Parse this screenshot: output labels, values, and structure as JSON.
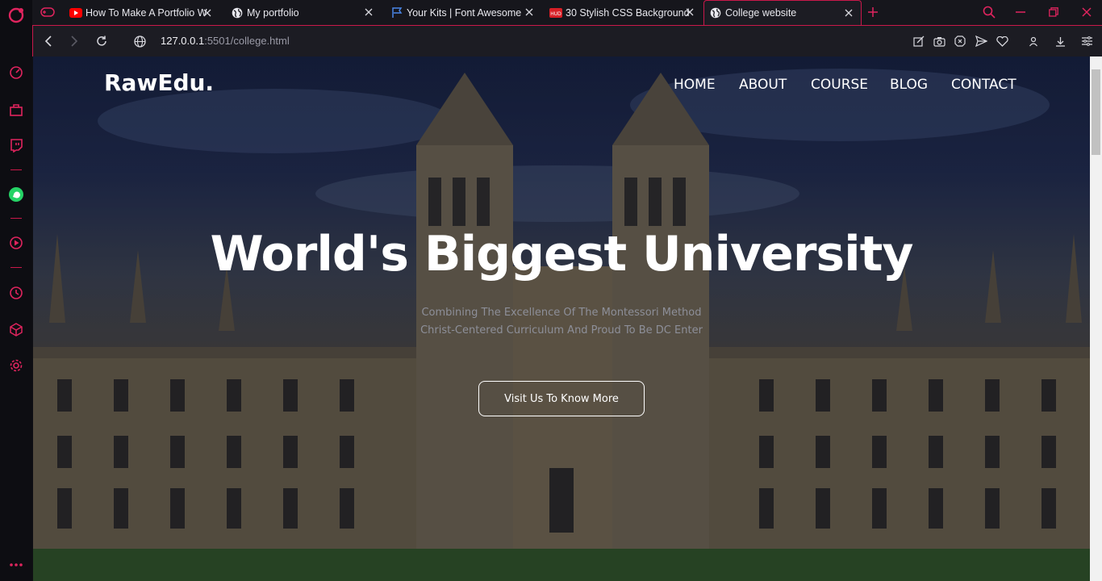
{
  "browser": {
    "tabs": [
      {
        "label": "How To Make A Portfolio W",
        "favicon": "youtube-icon"
      },
      {
        "label": "My portfolio",
        "favicon": "globe-icon"
      },
      {
        "label": "Your Kits | Font Awesome",
        "favicon": "flag-icon"
      },
      {
        "label": "30 Stylish CSS Background",
        "favicon": "hud-icon",
        "favicon_text": "HUD"
      },
      {
        "label": "College website",
        "favicon": "globe-icon",
        "active": true
      }
    ],
    "address": {
      "host": "127.0.0.1",
      "rest": ":5501/college.html"
    },
    "accent_color": "#c9184a"
  },
  "site": {
    "logo": "RawEdu.",
    "nav": [
      "HOME",
      "ABOUT",
      "COURSE",
      "BLOG",
      "CONTACT"
    ],
    "hero": {
      "title": "World's Biggest University",
      "subtitle_line1": "Combining The Excellence Of The Montessori Method",
      "subtitle_line2": "Christ-Centered Curriculum And Proud To Be DC Enter",
      "button": "Visit Us To Know More"
    }
  }
}
